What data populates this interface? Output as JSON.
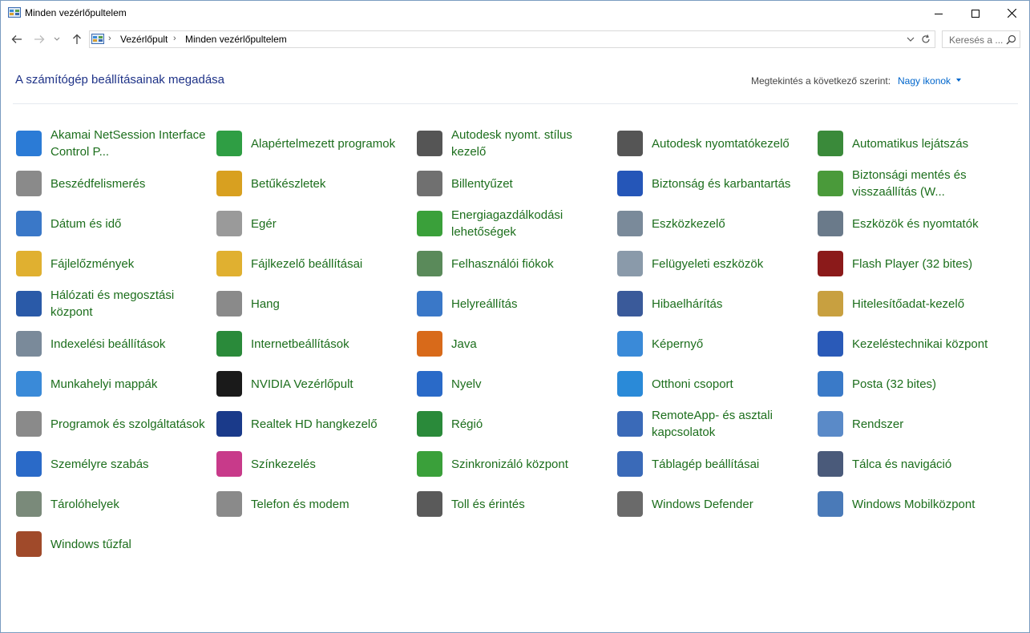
{
  "window": {
    "title": "Minden vezérlőpultelem"
  },
  "nav": {
    "breadcrumb": [
      "Vezérlőpult",
      "Minden vezérlőpultelem"
    ],
    "search_placeholder": "Keresés a ..."
  },
  "header": {
    "heading": "A számítógép beállításainak megadása",
    "view_by_label": "Megtekintés a következő szerint:",
    "view_by_value": "Nagy ikonok"
  },
  "items": [
    {
      "label": "Akamai NetSession Interface Control P...",
      "icon": "akamai-icon",
      "color": "#2b7bd6"
    },
    {
      "label": "Alapértelmezett programok",
      "icon": "default-programs-icon",
      "color": "#2f9e44"
    },
    {
      "label": "Autodesk nyomt. stílus kezelő",
      "icon": "printer-style-icon",
      "color": "#555555"
    },
    {
      "label": "Autodesk nyomtatókezelő",
      "icon": "printer-manager-icon",
      "color": "#555555"
    },
    {
      "label": "Automatikus lejátszás",
      "icon": "autoplay-icon",
      "color": "#3a8a3a"
    },
    {
      "label": "Beszédfelismerés",
      "icon": "microphone-icon",
      "color": "#8a8a8a"
    },
    {
      "label": "Betűkészletek",
      "icon": "fonts-icon",
      "color": "#d8a020"
    },
    {
      "label": "Billentyűzet",
      "icon": "keyboard-icon",
      "color": "#707070"
    },
    {
      "label": "Biztonság és karbantartás",
      "icon": "flag-icon",
      "color": "#2556b8"
    },
    {
      "label": "Biztonsági mentés és visszaállítás (W...",
      "icon": "backup-icon",
      "color": "#4a9a3a"
    },
    {
      "label": "Dátum és idő",
      "icon": "clock-icon",
      "color": "#3a78c8"
    },
    {
      "label": "Egér",
      "icon": "mouse-icon",
      "color": "#9a9a9a"
    },
    {
      "label": "Energiagazdálkodási lehetőségek",
      "icon": "battery-icon",
      "color": "#3aa03a"
    },
    {
      "label": "Eszközkezelő",
      "icon": "device-manager-icon",
      "color": "#7a8a9a"
    },
    {
      "label": "Eszközök és nyomtatók",
      "icon": "devices-printers-icon",
      "color": "#6a7a8a"
    },
    {
      "label": "Fájlelőzmények",
      "icon": "file-history-icon",
      "color": "#e0b030"
    },
    {
      "label": "Fájlkezelő beállításai",
      "icon": "folder-options-icon",
      "color": "#e0b030"
    },
    {
      "label": "Felhasználói fiókok",
      "icon": "users-icon",
      "color": "#5a8a5a"
    },
    {
      "label": "Felügyeleti eszközök",
      "icon": "admin-tools-icon",
      "color": "#8a9aaa"
    },
    {
      "label": "Flash Player (32 bites)",
      "icon": "flash-icon",
      "color": "#8b1a1a"
    },
    {
      "label": "Hálózati és megosztási központ",
      "icon": "network-icon",
      "color": "#2a5aa8"
    },
    {
      "label": "Hang",
      "icon": "speaker-icon",
      "color": "#8a8a8a"
    },
    {
      "label": "Helyreállítás",
      "icon": "recovery-icon",
      "color": "#3a78c8"
    },
    {
      "label": "Hibaelhárítás",
      "icon": "troubleshoot-icon",
      "color": "#3a5a9a"
    },
    {
      "label": "Hitelesítőadat-kezelő",
      "icon": "credential-icon",
      "color": "#c8a040"
    },
    {
      "label": "Indexelési beállítások",
      "icon": "indexing-icon",
      "color": "#7a8a9a"
    },
    {
      "label": "Internetbeállítások",
      "icon": "internet-options-icon",
      "color": "#2a8a3a"
    },
    {
      "label": "Java",
      "icon": "java-icon",
      "color": "#d86a1a"
    },
    {
      "label": "Képernyő",
      "icon": "display-icon",
      "color": "#3a8ad8"
    },
    {
      "label": "Kezeléstechnikai központ",
      "icon": "ease-of-access-icon",
      "color": "#2a5ab8"
    },
    {
      "label": "Munkahelyi mappák",
      "icon": "work-folders-icon",
      "color": "#3a8ad8"
    },
    {
      "label": "NVIDIA Vezérlőpult",
      "icon": "nvidia-icon",
      "color": "#1a1a1a"
    },
    {
      "label": "Nyelv",
      "icon": "language-icon",
      "color": "#2a6ac8"
    },
    {
      "label": "Otthoni csoport",
      "icon": "homegroup-icon",
      "color": "#2a8ad8"
    },
    {
      "label": "Posta (32 bites)",
      "icon": "mail-icon",
      "color": "#3a7ac8"
    },
    {
      "label": "Programok és szolgáltatások",
      "icon": "programs-icon",
      "color": "#8a8a8a"
    },
    {
      "label": "Realtek HD hangkezelő",
      "icon": "realtek-icon",
      "color": "#1a3a8a"
    },
    {
      "label": "Régió",
      "icon": "region-icon",
      "color": "#2a8a3a"
    },
    {
      "label": "RemoteApp- és asztali kapcsolatok",
      "icon": "remoteapp-icon",
      "color": "#3a6ab8"
    },
    {
      "label": "Rendszer",
      "icon": "system-icon",
      "color": "#5a8ac8"
    },
    {
      "label": "Személyre szabás",
      "icon": "personalization-icon",
      "color": "#2a6ac8"
    },
    {
      "label": "Színkezelés",
      "icon": "color-management-icon",
      "color": "#c83a8a"
    },
    {
      "label": "Szinkronizáló központ",
      "icon": "sync-icon",
      "color": "#3aa03a"
    },
    {
      "label": "Táblagép beállításai",
      "icon": "tablet-icon",
      "color": "#3a6ab8"
    },
    {
      "label": "Tálca és navigáció",
      "icon": "taskbar-icon",
      "color": "#4a5a7a"
    },
    {
      "label": "Tárolóhelyek",
      "icon": "storage-icon",
      "color": "#7a8a7a"
    },
    {
      "label": "Telefon és modem",
      "icon": "phone-icon",
      "color": "#8a8a8a"
    },
    {
      "label": "Toll és érintés",
      "icon": "pen-icon",
      "color": "#5a5a5a"
    },
    {
      "label": "Windows Defender",
      "icon": "defender-icon",
      "color": "#6a6a6a"
    },
    {
      "label": "Windows Mobilközpont",
      "icon": "mobility-icon",
      "color": "#4a7ab8"
    },
    {
      "label": "Windows tűzfal",
      "icon": "firewall-icon",
      "color": "#a04a2a"
    }
  ]
}
